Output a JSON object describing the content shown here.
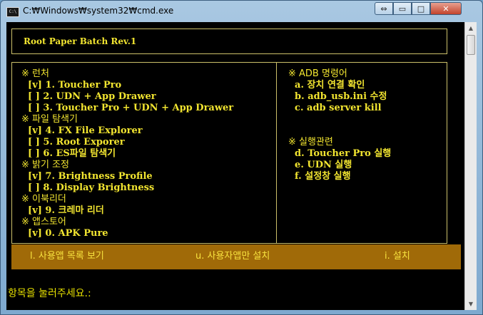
{
  "window": {
    "title": "C:₩Windows₩system32₩cmd.exe",
    "icon": "cmd-app-icon",
    "controls": {
      "restore": "⇔",
      "max": "□",
      "min": "▭",
      "close": "✕"
    }
  },
  "banner": {
    "title": "Root Paper Batch Rev.1"
  },
  "left_menu": [
    {
      "text": "※ 런처",
      "kind": "header"
    },
    {
      "text": "  [v] 1. Toucher Pro",
      "kind": "item"
    },
    {
      "text": "  [ ] 2. UDN + App Drawer",
      "kind": "item"
    },
    {
      "text": "  [ ] 3. Toucher Pro + UDN + App Drawer",
      "kind": "item"
    },
    {
      "text": "※ 파일 탐색기",
      "kind": "header"
    },
    {
      "text": "  [v] 4. FX File Explorer",
      "kind": "item"
    },
    {
      "text": "  [ ] 5. Root Exporer",
      "kind": "item"
    },
    {
      "text": "  [ ] 6. ES파일 탐색기",
      "kind": "item"
    },
    {
      "text": "※ 밝기 조정",
      "kind": "header"
    },
    {
      "text": "  [v] 7. Brightness Profile",
      "kind": "item"
    },
    {
      "text": "  [ ] 8. Display Brightness",
      "kind": "item"
    },
    {
      "text": "※ 이북리더",
      "kind": "header"
    },
    {
      "text": "  [v] 9. 크레마 리더",
      "kind": "item"
    },
    {
      "text": "※ 앱스토어",
      "kind": "header"
    },
    {
      "text": "  [v] 0. APK Pure",
      "kind": "item"
    }
  ],
  "right_menu": [
    {
      "text": "※ ADB 명령어",
      "kind": "header"
    },
    {
      "text": "  a. 장치 연결 확인",
      "kind": "item"
    },
    {
      "text": "  b. adb_usb.ini 수정",
      "kind": "item"
    },
    {
      "text": "  c. adb server kill",
      "kind": "item"
    },
    {
      "text": "",
      "kind": "blank"
    },
    {
      "text": "",
      "kind": "blank"
    },
    {
      "text": "※ 실행관련",
      "kind": "header"
    },
    {
      "text": "  d. Toucher Pro 실행",
      "kind": "item"
    },
    {
      "text": "  e. UDN 실행",
      "kind": "item"
    },
    {
      "text": "  f. 설정창 실행",
      "kind": "item"
    }
  ],
  "action_bar": {
    "option_l": "l. 사용앱 목록 보기",
    "option_u": "u. 사용자앱만 설치",
    "option_i": "i. 설치"
  },
  "prompt": "항목을 눌러주세요.:",
  "colors": {
    "text": "#f2e530",
    "border": "#ccc06a",
    "bar": "#a06a08",
    "console_bg": "#000000"
  }
}
